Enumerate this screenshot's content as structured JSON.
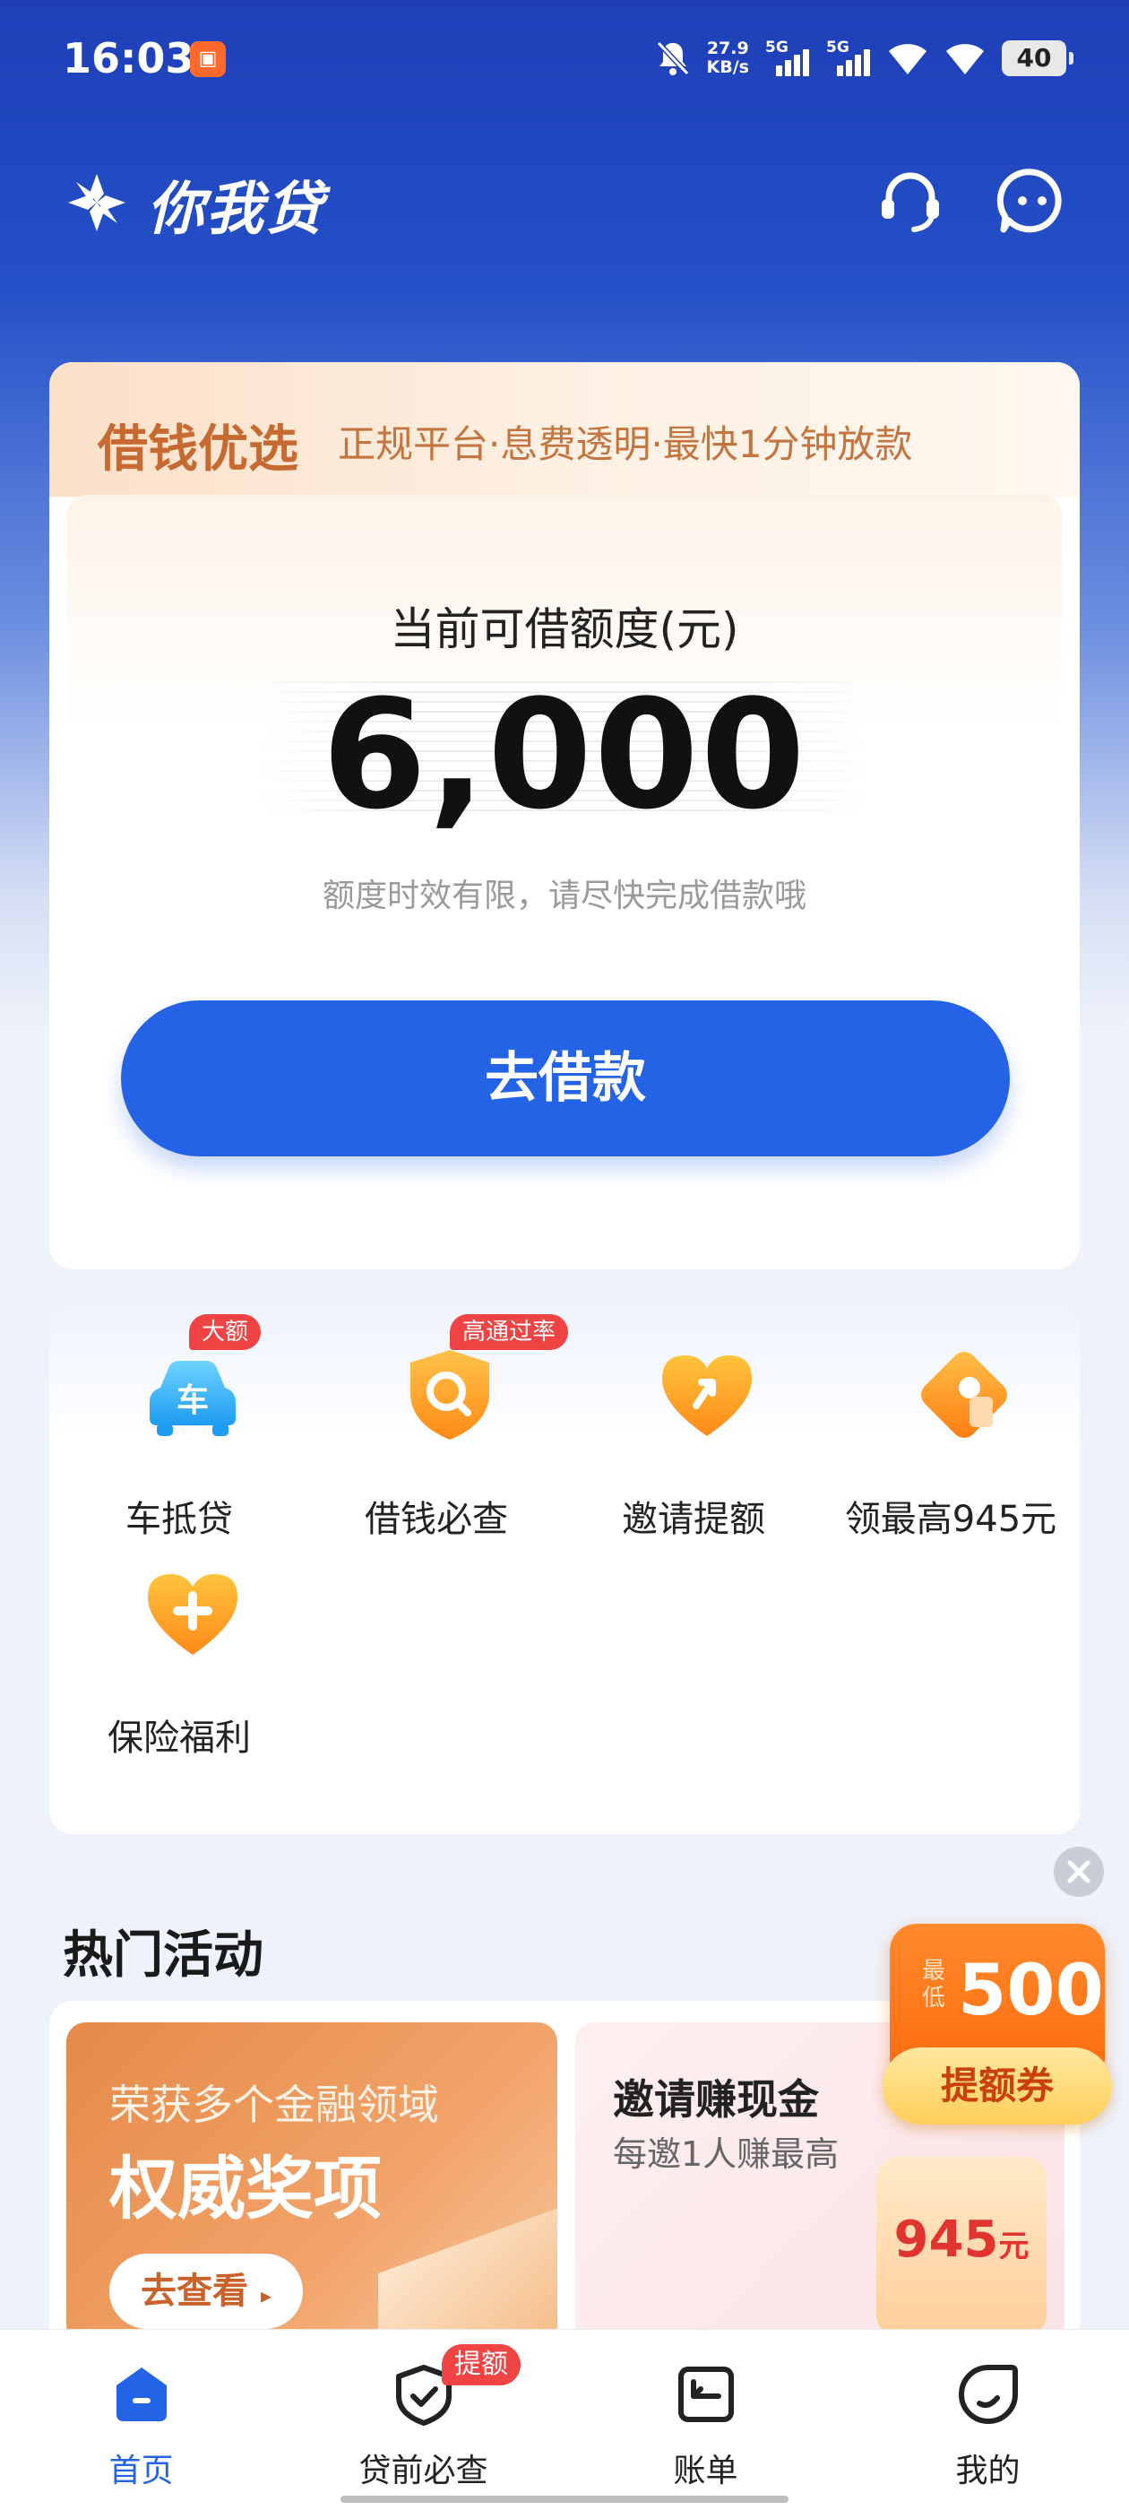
{
  "status_bar": {
    "time": "16:03",
    "network_speed_value": "27.9",
    "network_speed_unit": "KB/s",
    "sim1": "5G",
    "sim2": "5G",
    "battery": "40"
  },
  "header": {
    "app_name": "你我贷",
    "icons": [
      "customer-service-icon",
      "chat-icon"
    ]
  },
  "loan_card": {
    "title": "借钱优选",
    "subtitle": "正规平台·息费透明·最快1分钟放款",
    "quota_label": "当前可借额度(元)",
    "quota_value": "6,000",
    "quota_note": "额度时效有限，请尽快完成借款哦",
    "borrow_button": "去借款"
  },
  "services": [
    {
      "label": "车抵贷",
      "badge": "大额",
      "icon": "car-icon"
    },
    {
      "label": "借钱必查",
      "badge": "高通过率",
      "icon": "search-shield-icon"
    },
    {
      "label": "邀请提额",
      "badge": "",
      "icon": "heart-arrow-icon"
    },
    {
      "label": "领最高945元",
      "badge": "",
      "icon": "gift-tag-icon"
    },
    {
      "label": "保险福利",
      "badge": "",
      "icon": "heart-plus-icon"
    }
  ],
  "hot": {
    "title": "热门活动",
    "award": {
      "line1": "荣获多个金融领域",
      "line2": "权威奖项",
      "button": "去查看"
    },
    "invite": {
      "line1": "邀请赚现金",
      "line2": "每邀1人赚最高",
      "amount": "945",
      "unit": "元"
    }
  },
  "float_coupon": {
    "min_label": "最低",
    "value": "500",
    "ribbon": "提额券"
  },
  "nav": {
    "items": [
      {
        "label": "首页",
        "active": true
      },
      {
        "label": "贷前必查",
        "badge": "提额"
      },
      {
        "label": "账单"
      },
      {
        "label": "我的"
      }
    ]
  },
  "colors": {
    "brand_blue": "#2463e5",
    "header_blue": "#1e3fb8",
    "accent_orange": "#ff6a10",
    "badge_red": "#f04343",
    "loan_title": "#c66a32"
  }
}
